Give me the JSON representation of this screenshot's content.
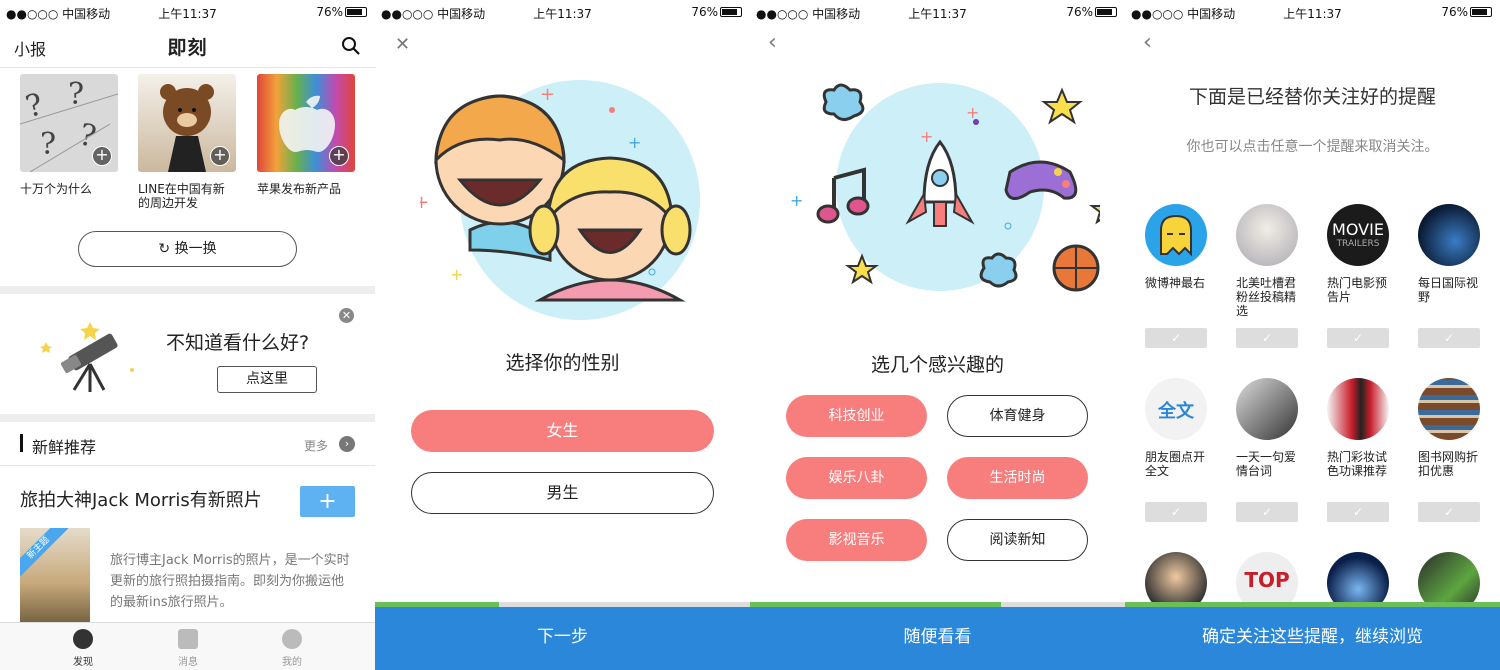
{
  "status": {
    "carrier": "●●○○○ 中国移动",
    "time": "上午11:37",
    "battery": "76%"
  },
  "s1": {
    "left_title": "小报",
    "logo": "即刻",
    "cards": [
      {
        "caption": "十万个为什么"
      },
      {
        "caption": "LINE在中国有新的周边开发"
      },
      {
        "caption": "苹果发布新产品"
      }
    ],
    "swap_label": "换一换",
    "prompt": {
      "title": "不知道看什么好?",
      "button": "点这里"
    },
    "section": {
      "title": "新鲜推荐",
      "more": "更多"
    },
    "article": {
      "title": "旅拍大神Jack Morris有新照片",
      "tag": "新主题",
      "desc": "旅行博主Jack Morris的照片，是一个实时更新的旅行照拍摄指南。即刻为你搬运他的最新ins旅行照片。"
    },
    "tabs": [
      {
        "label": "发现"
      },
      {
        "label": "消息"
      },
      {
        "label": "我的"
      }
    ]
  },
  "s2": {
    "heading": "选择你的性别",
    "female": "女生",
    "male": "男生",
    "cta": "下一步"
  },
  "s3": {
    "heading": "选几个感兴趣的",
    "interests": [
      "科技创业",
      "体育健身",
      "娱乐八卦",
      "生活时尚",
      "影视音乐",
      "阅读新知"
    ],
    "cta": "随便看看"
  },
  "s4": {
    "title": "下面是已经替你关注好的提醒",
    "subtitle": "你也可以点击任意一个提醒来取消关注。",
    "subs": [
      {
        "name": "微博神最右"
      },
      {
        "name": "北美吐槽君粉丝投稿精选"
      },
      {
        "name": "热门电影预告片",
        "logo": "MOVIE",
        "logo_sub": "TRAILERS"
      },
      {
        "name": "每日国际视野"
      },
      {
        "name": "朋友圈点开全文",
        "logo": "全文"
      },
      {
        "name": "一天一句爱情台词"
      },
      {
        "name": "热门彩妆试色功课推荐"
      },
      {
        "name": "图书网购折扣优惠"
      },
      {
        "name": ""
      },
      {
        "name": "",
        "logo": "TOP"
      },
      {
        "name": ""
      },
      {
        "name": ""
      }
    ],
    "check": "✓",
    "cta": "确定关注这些提醒，继续浏览"
  },
  "colors": {
    "accent_pink": "#f87e7e",
    "cta_blue": "#2a87d9",
    "progress_green": "#6bbf59"
  }
}
